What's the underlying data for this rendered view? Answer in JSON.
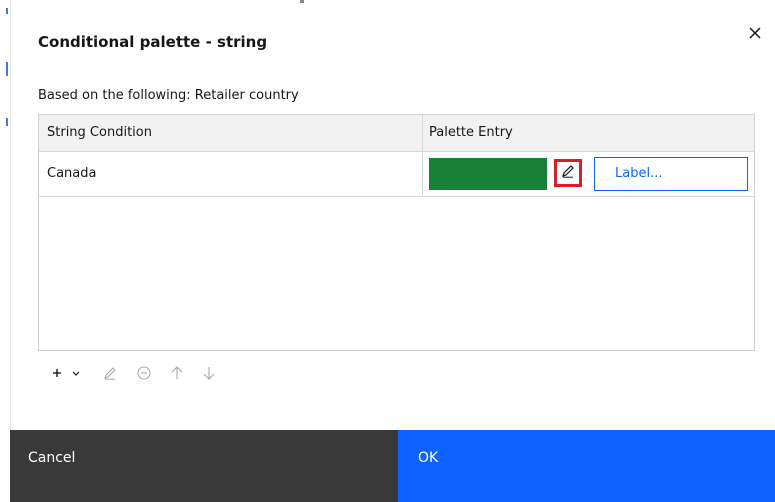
{
  "dialog": {
    "title": "Conditional palette - string",
    "close_icon": "close-icon"
  },
  "based_on": "Based on the following: Retailer country",
  "table": {
    "headers": [
      "String Condition",
      "Palette Entry"
    ],
    "rows": [
      {
        "condition": "Canada",
        "swatch_color": "#198038",
        "edit_icon": "pencil-icon",
        "label_button": "Label..."
      }
    ]
  },
  "toolbar": {
    "icons": [
      "add-icon",
      "chevron-down-icon",
      "edit-icon",
      "remove-icon",
      "arrow-up-icon",
      "arrow-down-icon"
    ]
  },
  "footer": {
    "cancel_label": "Cancel",
    "ok_label": "OK"
  },
  "colors": {
    "primary": "#0f62fe",
    "secondary": "#393939",
    "highlight": "#da1e28",
    "swatch": "#198038"
  }
}
